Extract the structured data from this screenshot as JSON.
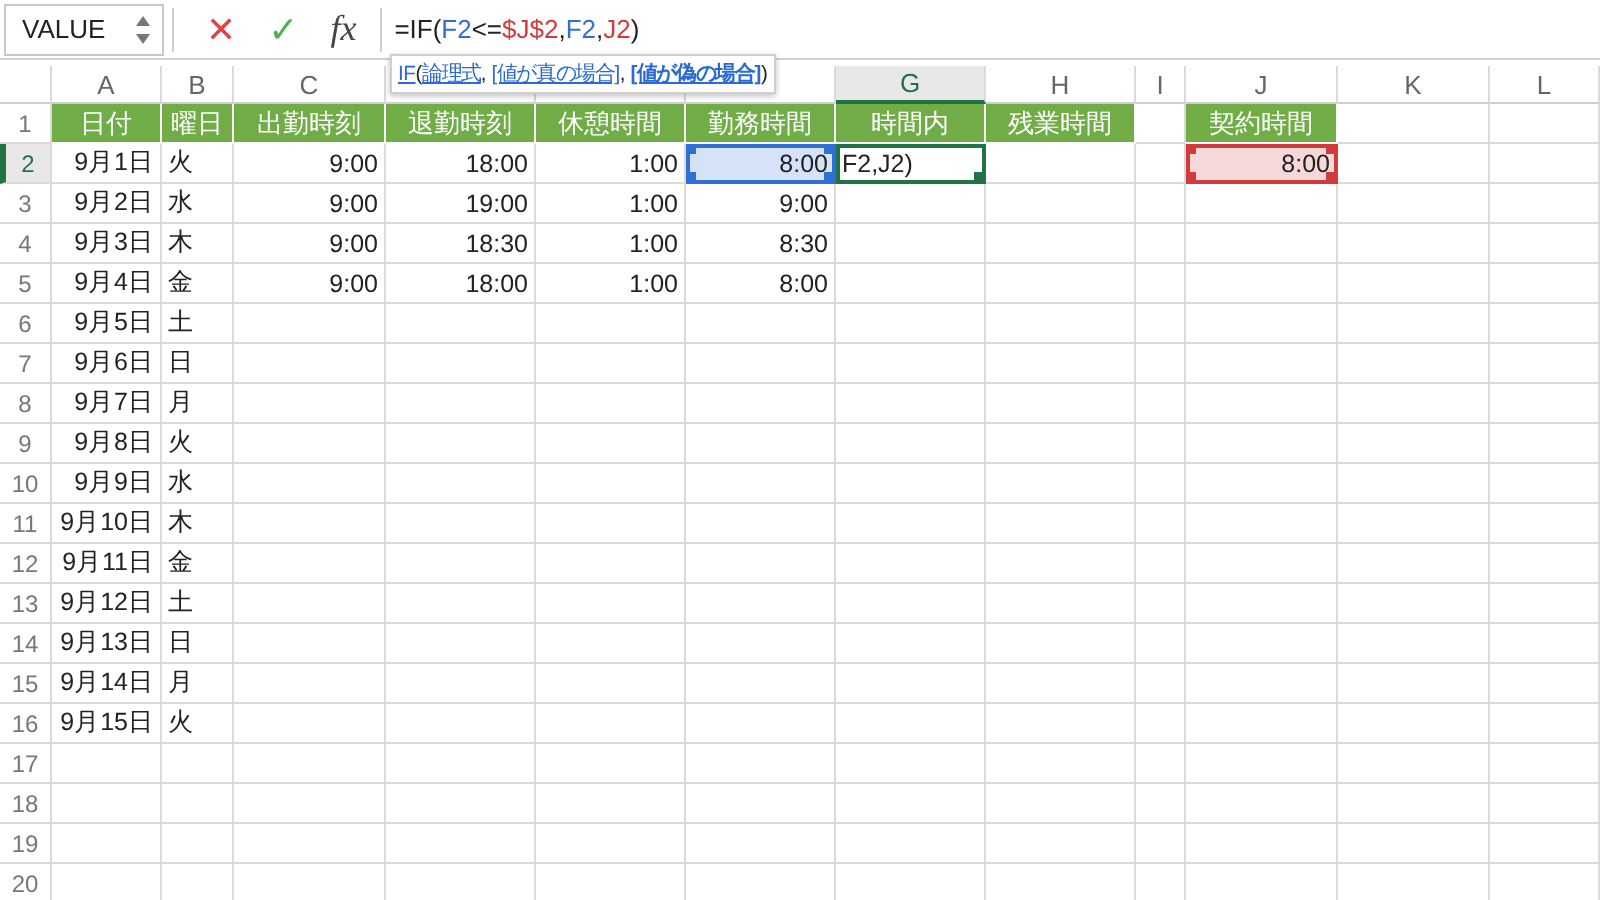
{
  "name_box": {
    "value": "VALUE"
  },
  "formula_bar": {
    "cancel": "✕",
    "enter": "✓",
    "function": "fx",
    "tokens": [
      {
        "kind": "plain",
        "text": "=IF("
      },
      {
        "kind": "ref",
        "text": "F2",
        "color": "#2f6fd6"
      },
      {
        "kind": "plain",
        "text": "<="
      },
      {
        "kind": "ref",
        "text": "$J$2",
        "color": "#d23b3b"
      },
      {
        "kind": "plain",
        "text": ","
      },
      {
        "kind": "ref",
        "text": "F2",
        "color": "#2f6fd6"
      },
      {
        "kind": "plain",
        "text": ","
      },
      {
        "kind": "ref",
        "text": "J2",
        "color": "#d23b3b"
      },
      {
        "kind": "plain",
        "text": ")"
      }
    ]
  },
  "tooltip": {
    "tokens": [
      {
        "kind": "link",
        "text": "IF",
        "current": false
      },
      {
        "kind": "plain",
        "text": "("
      },
      {
        "kind": "link",
        "text": "論理式",
        "current": false
      },
      {
        "kind": "plain",
        "text": ", "
      },
      {
        "kind": "link",
        "text": "[値が真の場合]",
        "current": false
      },
      {
        "kind": "plain",
        "text": ", "
      },
      {
        "kind": "link",
        "text": "[値が偽の場合]",
        "current": true
      },
      {
        "kind": "plain",
        "text": ")"
      }
    ]
  },
  "columns": [
    {
      "kind": "letter",
      "letter": "A",
      "selected": false
    },
    {
      "kind": "letter",
      "letter": "B",
      "selected": false
    },
    {
      "kind": "letter",
      "letter": "C",
      "selected": false
    },
    {
      "kind": "covered"
    },
    {
      "kind": "covered"
    },
    {
      "kind": "covered"
    },
    {
      "kind": "letter",
      "letter": "G",
      "selected": true
    },
    {
      "kind": "letter",
      "letter": "H",
      "selected": false
    },
    {
      "kind": "letter",
      "letter": "I",
      "selected": false
    },
    {
      "kind": "letter",
      "letter": "J",
      "selected": false
    },
    {
      "kind": "letter",
      "letter": "K",
      "selected": false
    },
    {
      "kind": "letter",
      "letter": "L",
      "selected": false
    }
  ],
  "rows": [
    {
      "number": "1",
      "selected": false,
      "cells": {
        "A": {
          "kind": "header",
          "text": "日付"
        },
        "B": {
          "kind": "header",
          "text": "曜日"
        },
        "C": {
          "kind": "header",
          "text": "出勤時刻"
        },
        "D": {
          "kind": "header",
          "text": "退勤時刻"
        },
        "E": {
          "kind": "header",
          "text": "休憩時間"
        },
        "F": {
          "kind": "header",
          "text": "勤務時間"
        },
        "G": {
          "kind": "header",
          "text": "時間内"
        },
        "H": {
          "kind": "header",
          "text": "残業時間"
        },
        "J": {
          "kind": "header",
          "text": "契約時間"
        }
      }
    },
    {
      "number": "2",
      "selected": true,
      "cells": {
        "A": {
          "kind": "value",
          "text": "9月1日"
        },
        "B": {
          "kind": "value",
          "text": "火"
        },
        "C": {
          "kind": "value",
          "text": "9:00"
        },
        "D": {
          "kind": "value",
          "text": "18:00"
        },
        "E": {
          "kind": "value",
          "text": "1:00"
        },
        "F": {
          "kind": "value",
          "text": "8:00",
          "color": "#2f6fd6"
        },
        "G": {
          "kind": "value",
          "text": "F2,J2)",
          "editing": true
        },
        "J": {
          "kind": "value",
          "text": "8:00",
          "color": "#d23b3b"
        }
      }
    },
    {
      "number": "3",
      "selected": false,
      "cells": {
        "A": {
          "kind": "value",
          "text": "9月2日"
        },
        "B": {
          "kind": "value",
          "text": "水"
        },
        "C": {
          "kind": "value",
          "text": "9:00"
        },
        "D": {
          "kind": "value",
          "text": "19:00"
        },
        "E": {
          "kind": "value",
          "text": "1:00"
        },
        "F": {
          "kind": "value",
          "text": "9:00"
        }
      }
    },
    {
      "number": "4",
      "selected": false,
      "cells": {
        "A": {
          "kind": "value",
          "text": "9月3日"
        },
        "B": {
          "kind": "value",
          "text": "木"
        },
        "C": {
          "kind": "value",
          "text": "9:00"
        },
        "D": {
          "kind": "value",
          "text": "18:30"
        },
        "E": {
          "kind": "value",
          "text": "1:00"
        },
        "F": {
          "kind": "value",
          "text": "8:30"
        }
      }
    },
    {
      "number": "5",
      "selected": false,
      "cells": {
        "A": {
          "kind": "value",
          "text": "9月4日"
        },
        "B": {
          "kind": "value",
          "text": "金"
        },
        "C": {
          "kind": "value",
          "text": "9:00"
        },
        "D": {
          "kind": "value",
          "text": "18:00"
        },
        "E": {
          "kind": "value",
          "text": "1:00"
        },
        "F": {
          "kind": "value",
          "text": "8:00"
        }
      }
    },
    {
      "number": "6",
      "selected": false,
      "cells": {
        "A": {
          "kind": "value",
          "text": "9月5日"
        },
        "B": {
          "kind": "value",
          "text": "土"
        }
      }
    },
    {
      "number": "7",
      "selected": false,
      "cells": {
        "A": {
          "kind": "value",
          "text": "9月6日"
        },
        "B": {
          "kind": "value",
          "text": "日"
        }
      }
    },
    {
      "number": "8",
      "selected": false,
      "cells": {
        "A": {
          "kind": "value",
          "text": "9月7日"
        },
        "B": {
          "kind": "value",
          "text": "月"
        }
      }
    },
    {
      "number": "9",
      "selected": false,
      "cells": {
        "A": {
          "kind": "value",
          "text": "9月8日"
        },
        "B": {
          "kind": "value",
          "text": "火"
        }
      }
    },
    {
      "number": "10",
      "selected": false,
      "cells": {
        "A": {
          "kind": "value",
          "text": "9月9日"
        },
        "B": {
          "kind": "value",
          "text": "水"
        }
      }
    },
    {
      "number": "11",
      "selected": false,
      "cells": {
        "A": {
          "kind": "value",
          "text": "9月10日"
        },
        "B": {
          "kind": "value",
          "text": "木"
        }
      }
    },
    {
      "number": "12",
      "selected": false,
      "cells": {
        "A": {
          "kind": "value",
          "text": "9月11日"
        },
        "B": {
          "kind": "value",
          "text": "金"
        }
      }
    },
    {
      "number": "13",
      "selected": false,
      "cells": {
        "A": {
          "kind": "value",
          "text": "9月12日"
        },
        "B": {
          "kind": "value",
          "text": "土"
        }
      }
    },
    {
      "number": "14",
      "selected": false,
      "cells": {
        "A": {
          "kind": "value",
          "text": "9月13日"
        },
        "B": {
          "kind": "value",
          "text": "日"
        }
      }
    },
    {
      "number": "15",
      "selected": false,
      "cells": {
        "A": {
          "kind": "value",
          "text": "9月14日"
        },
        "B": {
          "kind": "value",
          "text": "月"
        }
      }
    },
    {
      "number": "16",
      "selected": false,
      "cells": {
        "A": {
          "kind": "value",
          "text": "9月15日"
        },
        "B": {
          "kind": "value",
          "text": "火"
        }
      }
    },
    {
      "number": "17",
      "selected": false,
      "cells": {}
    },
    {
      "number": "18",
      "selected": false,
      "cells": {}
    },
    {
      "number": "19",
      "selected": false,
      "cells": {}
    },
    {
      "number": "20",
      "selected": false,
      "cells": {}
    }
  ]
}
